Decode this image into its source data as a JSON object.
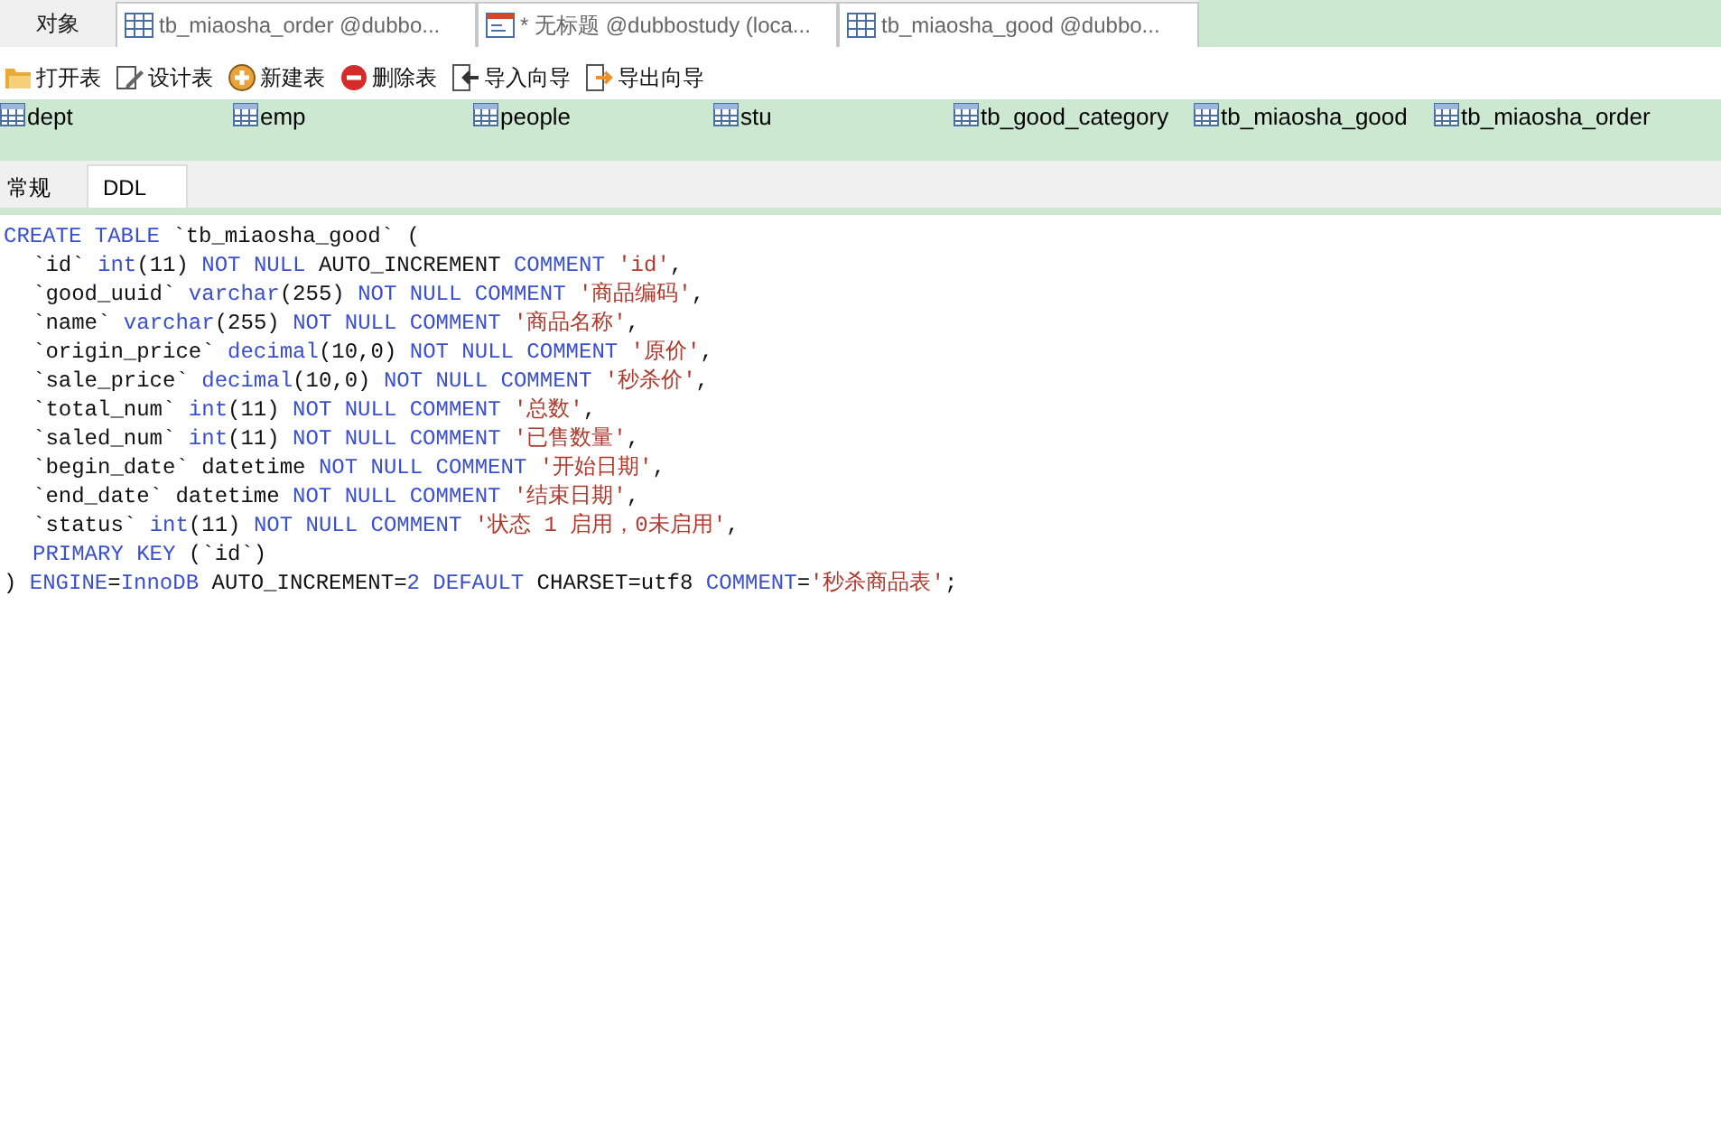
{
  "tabs": [
    {
      "label": "对象",
      "selected": true,
      "kind": "plain"
    },
    {
      "label": "tb_miaosha_order @dubbo...",
      "selected": false,
      "kind": "table"
    },
    {
      "label": "* 无标题 @dubbostudy (loca...",
      "selected": false,
      "kind": "query"
    },
    {
      "label": "tb_miaosha_good @dubbo...",
      "selected": false,
      "kind": "table"
    }
  ],
  "toolbar": [
    {
      "label": "打开表",
      "kind": "open"
    },
    {
      "label": "设计表",
      "kind": "design"
    },
    {
      "label": "新建表",
      "kind": "new"
    },
    {
      "label": "删除表",
      "kind": "delete"
    },
    {
      "label": "导入向导",
      "kind": "import"
    },
    {
      "label": "导出向导",
      "kind": "export"
    }
  ],
  "objects": [
    "dept",
    "emp",
    "people",
    "stu",
    "tb_good_category",
    "tb_miaosha_good",
    "tb_miaosha_order"
  ],
  "subtabs": [
    {
      "label": "常规",
      "selected": false
    },
    {
      "label": "DDL",
      "selected": true
    }
  ],
  "code_lines": [
    {
      "indent": false,
      "tokens": [
        {
          "kind": "keyword",
          "text": "CREATE TABLE"
        },
        {
          "kind": "plain",
          "text": "`tb_miaosha_good` ("
        }
      ]
    },
    {
      "indent": true,
      "tokens": [
        {
          "kind": "plain",
          "text": "`id`"
        },
        {
          "kind": "keyword",
          "text": "int"
        },
        {
          "kind": "plain",
          "text": "(11)",
          "tight": true
        },
        {
          "kind": "keyword",
          "text": "NOT NULL"
        },
        {
          "kind": "plain",
          "text": "AUTO_INCREMENT"
        },
        {
          "kind": "keyword",
          "text": "COMMENT"
        },
        {
          "kind": "string",
          "text": "'id'"
        },
        {
          "kind": "plain",
          "text": ",",
          "tight": true
        }
      ]
    },
    {
      "indent": true,
      "tokens": [
        {
          "kind": "plain",
          "text": "`good_uuid`"
        },
        {
          "kind": "keyword",
          "text": "varchar"
        },
        {
          "kind": "plain",
          "text": "(255)",
          "tight": true
        },
        {
          "kind": "keyword",
          "text": "NOT NULL COMMENT"
        },
        {
          "kind": "string",
          "text": "'商品编码'"
        },
        {
          "kind": "plain",
          "text": ",",
          "tight": true
        }
      ]
    },
    {
      "indent": true,
      "tokens": [
        {
          "kind": "plain",
          "text": "`name`"
        },
        {
          "kind": "keyword",
          "text": "varchar"
        },
        {
          "kind": "plain",
          "text": "(255)",
          "tight": true
        },
        {
          "kind": "keyword",
          "text": "NOT NULL COMMENT"
        },
        {
          "kind": "string",
          "text": "'商品名称'"
        },
        {
          "kind": "plain",
          "text": ",",
          "tight": true
        }
      ]
    },
    {
      "indent": true,
      "tokens": [
        {
          "kind": "plain",
          "text": "`origin_price`"
        },
        {
          "kind": "keyword",
          "text": "decimal"
        },
        {
          "kind": "plain",
          "text": "(10,0)",
          "tight": true
        },
        {
          "kind": "keyword",
          "text": "NOT NULL COMMENT"
        },
        {
          "kind": "string",
          "text": "'原价'"
        },
        {
          "kind": "plain",
          "text": ",",
          "tight": true
        }
      ]
    },
    {
      "indent": true,
      "tokens": [
        {
          "kind": "plain",
          "text": "`sale_price`"
        },
        {
          "kind": "keyword",
          "text": "decimal"
        },
        {
          "kind": "plain",
          "text": "(10,0)",
          "tight": true
        },
        {
          "kind": "keyword",
          "text": "NOT NULL COMMENT"
        },
        {
          "kind": "string",
          "text": "'秒杀价'"
        },
        {
          "kind": "plain",
          "text": ",",
          "tight": true
        }
      ]
    },
    {
      "indent": true,
      "tokens": [
        {
          "kind": "plain",
          "text": "`total_num`"
        },
        {
          "kind": "keyword",
          "text": "int"
        },
        {
          "kind": "plain",
          "text": "(11)",
          "tight": true
        },
        {
          "kind": "keyword",
          "text": "NOT NULL COMMENT"
        },
        {
          "kind": "string",
          "text": "'总数'"
        },
        {
          "kind": "plain",
          "text": ",",
          "tight": true
        }
      ]
    },
    {
      "indent": true,
      "tokens": [
        {
          "kind": "plain",
          "text": "`saled_num`"
        },
        {
          "kind": "keyword",
          "text": "int"
        },
        {
          "kind": "plain",
          "text": "(11)",
          "tight": true
        },
        {
          "kind": "keyword",
          "text": "NOT NULL COMMENT"
        },
        {
          "kind": "string",
          "text": "'已售数量'"
        },
        {
          "kind": "plain",
          "text": ",",
          "tight": true
        }
      ]
    },
    {
      "indent": true,
      "tokens": [
        {
          "kind": "plain",
          "text": "`begin_date` datetime"
        },
        {
          "kind": "keyword",
          "text": "NOT NULL COMMENT"
        },
        {
          "kind": "string",
          "text": "'开始日期'"
        },
        {
          "kind": "plain",
          "text": ",",
          "tight": true
        }
      ]
    },
    {
      "indent": true,
      "tokens": [
        {
          "kind": "plain",
          "text": "`end_date` datetime"
        },
        {
          "kind": "keyword",
          "text": "NOT NULL COMMENT"
        },
        {
          "kind": "string",
          "text": "'结束日期'"
        },
        {
          "kind": "plain",
          "text": ",",
          "tight": true
        }
      ]
    },
    {
      "indent": true,
      "tokens": [
        {
          "kind": "plain",
          "text": "`status`"
        },
        {
          "kind": "keyword",
          "text": "int"
        },
        {
          "kind": "plain",
          "text": "(11)",
          "tight": true
        },
        {
          "kind": "keyword",
          "text": "NOT NULL COMMENT"
        },
        {
          "kind": "string",
          "text": "'状态 1 启用，0未启用'"
        },
        {
          "kind": "plain",
          "text": ",",
          "tight": true
        }
      ]
    },
    {
      "indent": true,
      "tokens": [
        {
          "kind": "keyword",
          "text": "PRIMARY KEY"
        },
        {
          "kind": "plain",
          "text": "(`id`)"
        }
      ]
    },
    {
      "indent": false,
      "tokens": [
        {
          "kind": "plain",
          "text": ")"
        },
        {
          "kind": "keyword",
          "text": "ENGINE"
        },
        {
          "kind": "plain",
          "text": "=",
          "tight": true
        },
        {
          "kind": "keyword",
          "text": "InnoDB",
          "tight": true
        },
        {
          "kind": "plain",
          "text": "AUTO_INCREMENT="
        },
        {
          "kind": "keyword",
          "text": "2 DEFAULT",
          "tight": true
        },
        {
          "kind": "plain",
          "text": "CHARSET=utf8"
        },
        {
          "kind": "keyword",
          "text": "COMMENT"
        },
        {
          "kind": "plain",
          "text": "=",
          "tight": true
        },
        {
          "kind": "string",
          "text": "'秒杀商品表'",
          "tight": true
        },
        {
          "kind": "plain",
          "text": ";",
          "tight": true
        }
      ]
    }
  ]
}
